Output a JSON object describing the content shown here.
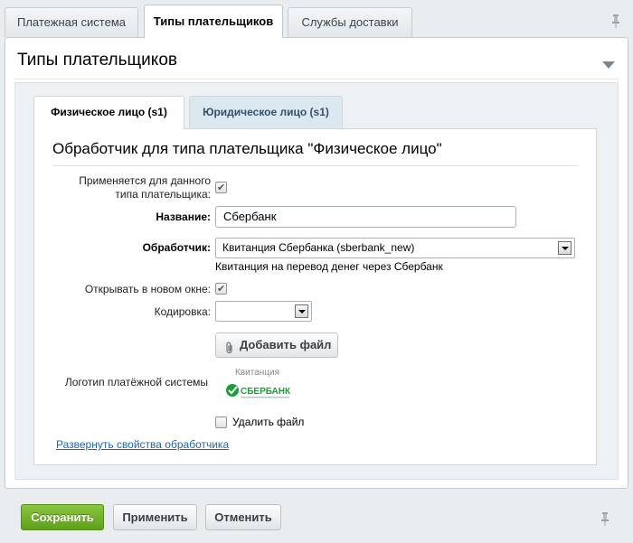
{
  "top_tabs": [
    {
      "label": "Платежная система"
    },
    {
      "label": "Типы плательщиков"
    },
    {
      "label": "Службы доставки"
    }
  ],
  "panel": {
    "title": "Типы плательщиков"
  },
  "inner_tabs": [
    {
      "label": "Физическое лицо (s1)"
    },
    {
      "label": "Юридическое лицо (s1)"
    }
  ],
  "handler": {
    "title": "Обработчик для типа плательщика \"Физическое лицо\"",
    "applies_label_line1": "Применяется для данного",
    "applies_label_line2": "типа плательщика:",
    "name_label": "Название:",
    "name_value": "Сбербанк",
    "handler_label": "Обработчик:",
    "handler_value": "Квитанция Сбербанка (sberbank_new)",
    "handler_hint": "Квитанция на перевод денег через Сбербанк",
    "new_window_label": "Открывать в новом окне:",
    "encoding_label": "Кодировка:",
    "encoding_value": "",
    "add_file_label": "Добавить файл",
    "logo_label": "Логотип платёжной системы",
    "logo_caption": "Квитанция",
    "logo_text": "СБЕРБАНК",
    "delete_file_label": "Удалить файл",
    "expand_link": "Развернуть свойства обработчика"
  },
  "footer": {
    "save_label": "Сохранить",
    "apply_label": "Применить",
    "cancel_label": "Отменить"
  },
  "colors": {
    "save_button": "#6aab25",
    "link": "#2067b0",
    "inactive_tab": "#dce8f0"
  }
}
